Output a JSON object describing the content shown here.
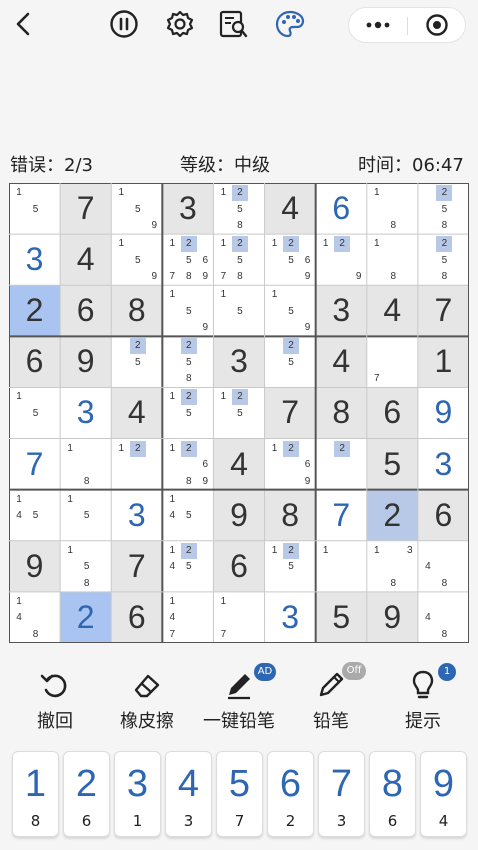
{
  "status": {
    "errors_label": "错误：2/3",
    "level_label": "等级：中级",
    "time_label": "时间：06:47"
  },
  "colors": {
    "accent": "#2d66b3",
    "given_shade": "#e6e6e6",
    "selected": "#a9c4f0",
    "same_number": "#b8c9e8",
    "candidate_highlight": "#b8c9e8"
  },
  "board": {
    "rows": [
      [
        {
          "v": "",
          "c": [
            "1",
            "5"
          ]
        },
        {
          "v": "7",
          "g": true
        },
        {
          "v": "",
          "c": [
            "1",
            "5",
            "9"
          ]
        },
        {
          "v": "3",
          "g": true
        },
        {
          "v": "",
          "c": [
            "1",
            "2",
            "5",
            "8"
          ],
          "h": [
            "2"
          ]
        },
        {
          "v": "4",
          "g": true
        },
        {
          "v": "6",
          "u": true
        },
        {
          "v": "",
          "c": [
            "1",
            "8"
          ]
        },
        {
          "v": "",
          "c": [
            "2",
            "5",
            "8"
          ],
          "h": [
            "2"
          ]
        }
      ],
      [
        {
          "v": "3",
          "u": true
        },
        {
          "v": "4",
          "g": true
        },
        {
          "v": "",
          "c": [
            "1",
            "5",
            "9"
          ]
        },
        {
          "v": "",
          "c": [
            "1",
            "2",
            "5",
            "6",
            "7",
            "8",
            "9"
          ],
          "h": [
            "2"
          ]
        },
        {
          "v": "",
          "c": [
            "1",
            "2",
            "5",
            "7",
            "8"
          ],
          "h": [
            "2"
          ]
        },
        {
          "v": "",
          "c": [
            "1",
            "2",
            "5",
            "6",
            "9"
          ],
          "h": [
            "2"
          ]
        },
        {
          "v": "",
          "c": [
            "1",
            "2",
            "9"
          ],
          "h": [
            "2"
          ]
        },
        {
          "v": "",
          "c": [
            "1",
            "8"
          ]
        },
        {
          "v": "",
          "c": [
            "2",
            "5",
            "8"
          ],
          "h": [
            "2"
          ]
        }
      ],
      [
        {
          "v": "2",
          "g": true,
          "sel": true
        },
        {
          "v": "6",
          "g": true
        },
        {
          "v": "8",
          "g": true
        },
        {
          "v": "",
          "c": [
            "1",
            "5",
            "9"
          ]
        },
        {
          "v": "",
          "c": [
            "1",
            "5"
          ]
        },
        {
          "v": "",
          "c": [
            "1",
            "5",
            "9"
          ]
        },
        {
          "v": "3",
          "g": true
        },
        {
          "v": "4",
          "g": true
        },
        {
          "v": "7",
          "g": true
        }
      ],
      [
        {
          "v": "6",
          "g": true
        },
        {
          "v": "9",
          "g": true
        },
        {
          "v": "",
          "c": [
            "2",
            "5"
          ],
          "h": [
            "2"
          ]
        },
        {
          "v": "",
          "c": [
            "2",
            "5",
            "8"
          ],
          "h": [
            "2"
          ]
        },
        {
          "v": "3",
          "g": true
        },
        {
          "v": "",
          "c": [
            "2",
            "5"
          ],
          "h": [
            "2"
          ]
        },
        {
          "v": "4",
          "g": true
        },
        {
          "v": "",
          "c": [
            "7"
          ]
        },
        {
          "v": "1",
          "g": true
        }
      ],
      [
        {
          "v": "",
          "c": [
            "1",
            "5"
          ]
        },
        {
          "v": "3",
          "u": true
        },
        {
          "v": "4",
          "g": true
        },
        {
          "v": "",
          "c": [
            "1",
            "2",
            "5"
          ],
          "h": [
            "2"
          ]
        },
        {
          "v": "",
          "c": [
            "1",
            "2",
            "5"
          ],
          "h": [
            "2"
          ]
        },
        {
          "v": "7",
          "g": true
        },
        {
          "v": "8",
          "g": true
        },
        {
          "v": "6",
          "g": true
        },
        {
          "v": "9",
          "u": true
        }
      ],
      [
        {
          "v": "7",
          "u": true
        },
        {
          "v": "",
          "c": [
            "1",
            "8"
          ]
        },
        {
          "v": "",
          "c": [
            "1",
            "2"
          ],
          "h": [
            "2"
          ]
        },
        {
          "v": "",
          "c": [
            "1",
            "2",
            "6",
            "8",
            "9"
          ],
          "h": [
            "2"
          ]
        },
        {
          "v": "4",
          "g": true
        },
        {
          "v": "",
          "c": [
            "1",
            "2",
            "6",
            "9"
          ],
          "h": [
            "2"
          ]
        },
        {
          "v": "",
          "c": [
            "2"
          ],
          "h": [
            "2"
          ]
        },
        {
          "v": "5",
          "g": true
        },
        {
          "v": "3",
          "u": true
        }
      ],
      [
        {
          "v": "",
          "c": [
            "1",
            "4",
            "5"
          ]
        },
        {
          "v": "",
          "c": [
            "1",
            "5"
          ]
        },
        {
          "v": "3",
          "u": true
        },
        {
          "v": "",
          "c": [
            "1",
            "4",
            "5"
          ]
        },
        {
          "v": "9",
          "g": true
        },
        {
          "v": "8",
          "g": true
        },
        {
          "v": "7",
          "u": true
        },
        {
          "v": "2",
          "g": true,
          "same": true
        },
        {
          "v": "6",
          "g": true
        }
      ],
      [
        {
          "v": "9",
          "g": true
        },
        {
          "v": "",
          "c": [
            "1",
            "5",
            "8"
          ]
        },
        {
          "v": "7",
          "g": true
        },
        {
          "v": "",
          "c": [
            "1",
            "2",
            "4",
            "5"
          ],
          "h": [
            "2"
          ]
        },
        {
          "v": "6",
          "g": true
        },
        {
          "v": "",
          "c": [
            "1",
            "2",
            "5"
          ],
          "h": [
            "2"
          ]
        },
        {
          "v": "",
          "c": [
            "1"
          ]
        },
        {
          "v": "",
          "c": [
            "1",
            "3",
            "8"
          ]
        },
        {
          "v": "",
          "c": [
            "4",
            "8"
          ]
        }
      ],
      [
        {
          "v": "",
          "c": [
            "1",
            "4",
            "8"
          ]
        },
        {
          "v": "2",
          "u": true,
          "same": true
        },
        {
          "v": "6",
          "g": true
        },
        {
          "v": "",
          "c": [
            "1",
            "4",
            "7"
          ]
        },
        {
          "v": "",
          "c": [
            "1",
            "7"
          ]
        },
        {
          "v": "3",
          "u": true
        },
        {
          "v": "5",
          "g": true
        },
        {
          "v": "9",
          "g": true
        },
        {
          "v": "",
          "c": [
            "4",
            "8"
          ]
        }
      ]
    ]
  },
  "tools": [
    {
      "label": "撤回",
      "icon": "undo-icon"
    },
    {
      "label": "橡皮擦",
      "icon": "eraser-icon"
    },
    {
      "label": "一键铅笔",
      "icon": "auto-pencil-icon",
      "badge": "AD"
    },
    {
      "label": "铅笔",
      "icon": "pencil-icon",
      "badge": "Off"
    },
    {
      "label": "提示",
      "icon": "lightbulb-icon",
      "badge": "1"
    }
  ],
  "numpad": [
    {
      "digit": "1",
      "count": "8"
    },
    {
      "digit": "2",
      "count": "6"
    },
    {
      "digit": "3",
      "count": "1"
    },
    {
      "digit": "4",
      "count": "3"
    },
    {
      "digit": "5",
      "count": "7"
    },
    {
      "digit": "6",
      "count": "2"
    },
    {
      "digit": "7",
      "count": "3"
    },
    {
      "digit": "8",
      "count": "6"
    },
    {
      "digit": "9",
      "count": "4"
    }
  ]
}
